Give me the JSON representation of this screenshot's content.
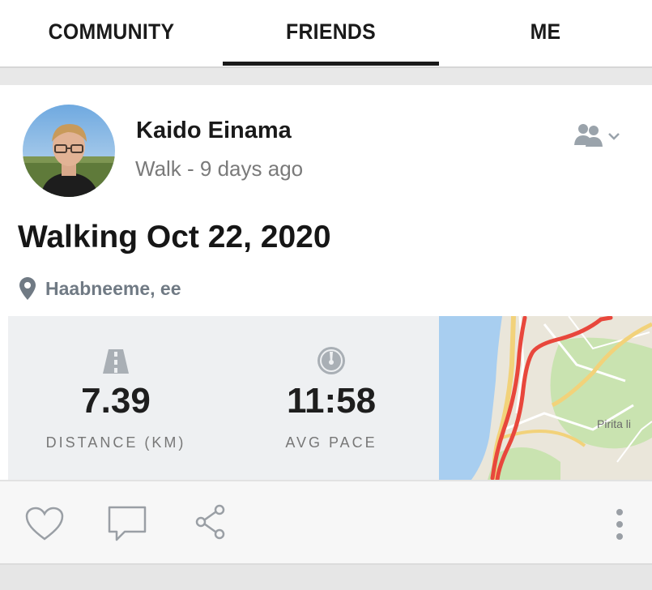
{
  "tabs": [
    {
      "label": "COMMUNITY",
      "active": false
    },
    {
      "label": "FRIENDS",
      "active": true
    },
    {
      "label": "ME",
      "active": false
    }
  ],
  "post": {
    "user_name": "Kaido Einama",
    "meta": "Walk - 9 days ago",
    "title": "Walking Oct 22, 2020",
    "location": "Haabneeme, ee",
    "privacy_icon": "friends-icon"
  },
  "stats": [
    {
      "icon": "road-icon",
      "value": "7.39",
      "label": "DISTANCE (KM)"
    },
    {
      "icon": "speedometer-icon",
      "value": "11:58",
      "label": "AVG PACE"
    }
  ],
  "map": {
    "label": "Pirita li",
    "colors": {
      "route": "#e8473c",
      "water": "#a8cef0",
      "park": "#c9e3b0",
      "road": "#f2d27a"
    }
  },
  "actions": {
    "like_icon": "heart-icon",
    "comment_icon": "comment-icon",
    "share_icon": "share-icon",
    "more_icon": "more-icon"
  }
}
